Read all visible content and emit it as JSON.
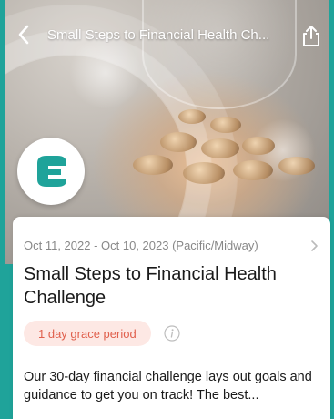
{
  "header": {
    "title": "Small Steps to Financial Health Ch...",
    "back_icon": "chevron-left-icon",
    "share_icon": "share-icon"
  },
  "hero": {
    "logo_icon": "brand-logo-icon"
  },
  "card": {
    "dates": "Oct 11, 2022 - Oct 10, 2023 (Pacific/Midway)",
    "title": "Small Steps to Financial Health Challenge",
    "grace_period": "1 day grace period",
    "description": "Our 30-day financial challenge lays out goals and guidance to get you on track! The best..."
  },
  "colors": {
    "background": "#1fa39a",
    "badge_bg": "#fde8e4",
    "badge_text": "#e0604d"
  }
}
